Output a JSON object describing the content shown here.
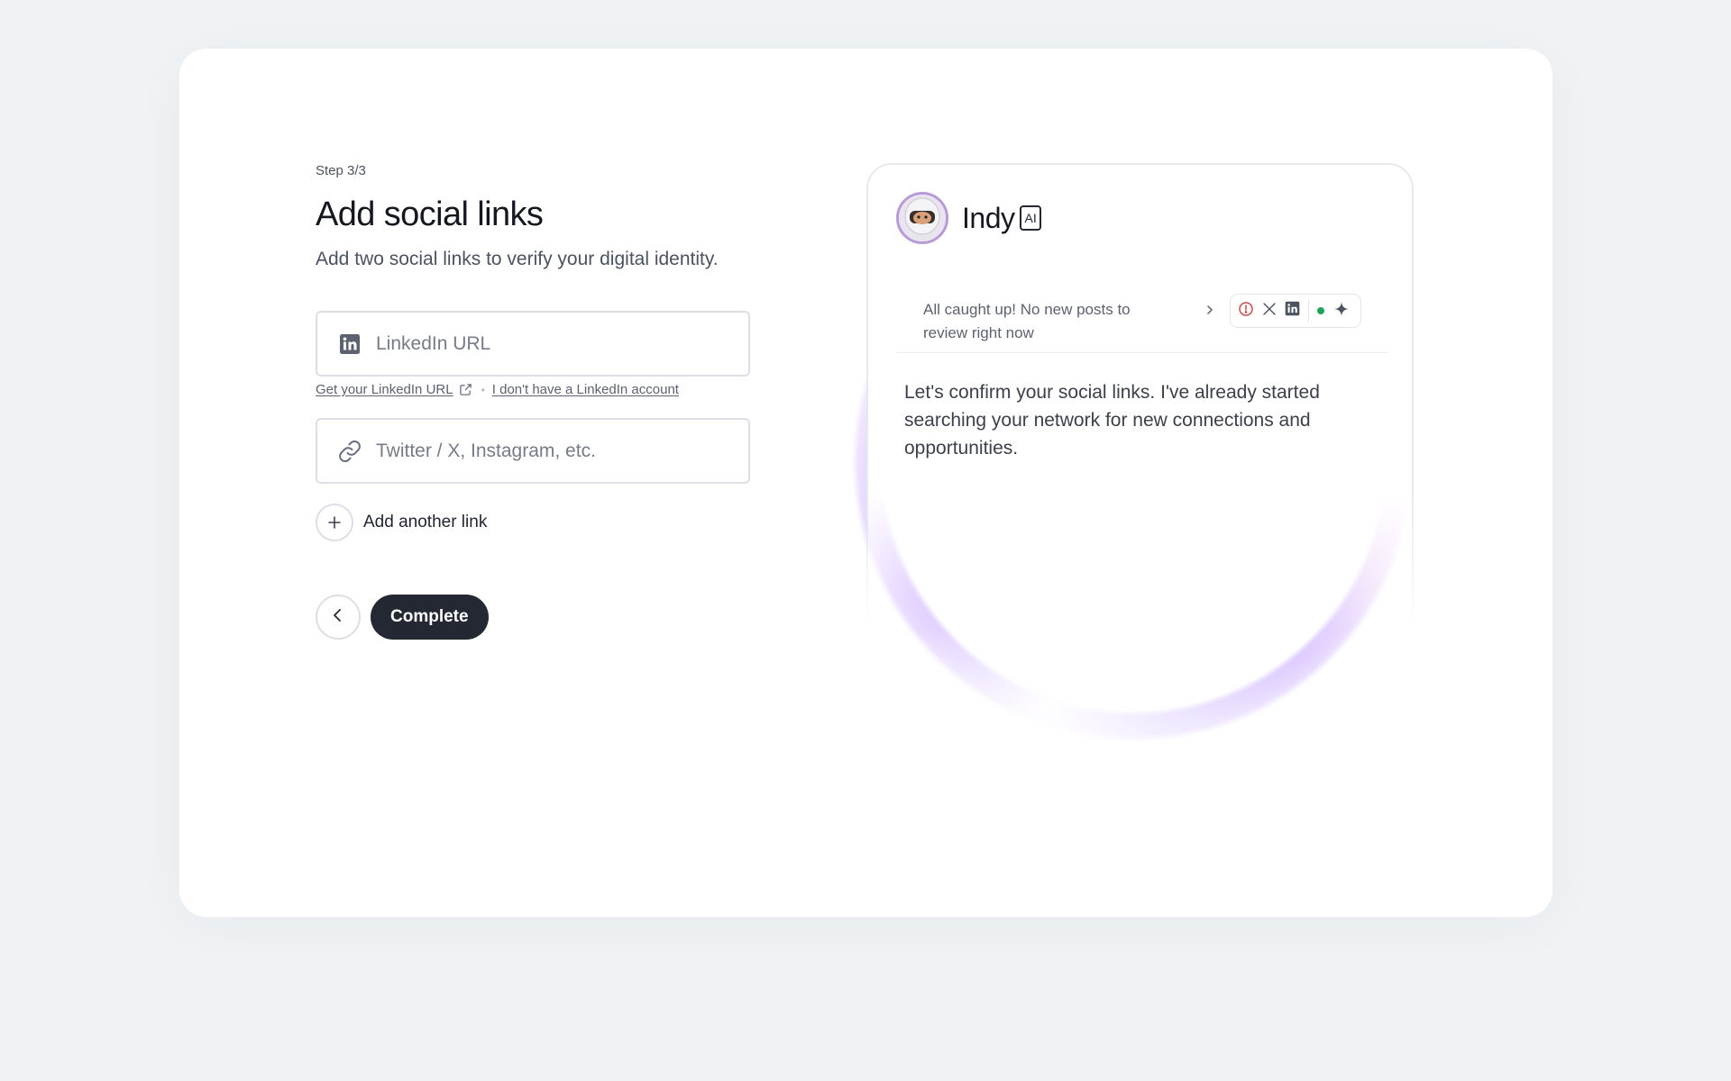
{
  "form": {
    "step": "Step 3/3",
    "title": "Add social links",
    "subtitle": "Add two social links to verify your digital identity.",
    "linkedin_placeholder": "LinkedIn URL",
    "linkedin_icon": "linkedin-icon",
    "get_linkedin_link": "Get your LinkedIn URL",
    "no_linkedin_link": "I don't have a LinkedIn account",
    "other_placeholder": "Twitter / X, Instagram, etc.",
    "other_icon": "link-icon",
    "add_link_label": "Add another link",
    "complete_label": "Complete"
  },
  "preview": {
    "bot_name": "Indy",
    "badge": "AI",
    "status_text": "All caught up! No new posts to review right now",
    "status_icons": [
      "alert-circle-icon",
      "x-logo-icon",
      "linkedin-icon",
      "online-dot",
      "sparkle-icon"
    ],
    "message": "Let's confirm your social links. I've already started searching your network for new connections and opportunities."
  },
  "colors": {
    "background": "#f0f3f6",
    "card": "#ffffff",
    "primary_button": "#232833",
    "online": "#1ea35b",
    "alert": "#c0504d",
    "halo": "#a878ff"
  }
}
